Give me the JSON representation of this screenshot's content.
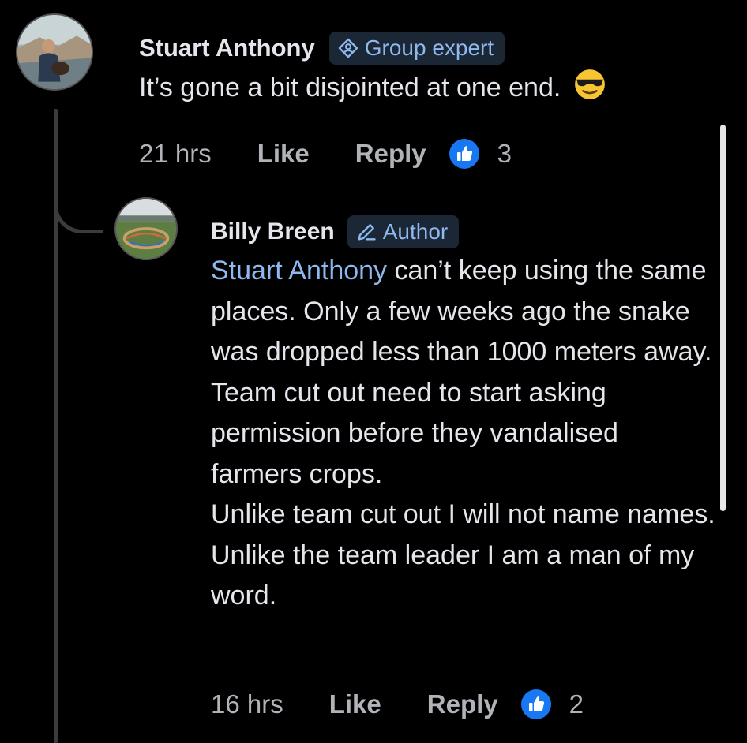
{
  "comment1": {
    "author": "Stuart Anthony",
    "badge": "Group expert",
    "badge_icon": "group-expert-icon",
    "text": "It’s gone a bit disjointed at one end.",
    "emoji": "smiling-face-with-sunglasses",
    "time": "21 hrs",
    "like_label": "Like",
    "reply_label": "Reply",
    "reaction": "like",
    "reaction_count": "3"
  },
  "comment2": {
    "author": "Billy Breen",
    "badge": "Author",
    "badge_icon": "pencil-icon",
    "mention": "Stuart Anthony",
    "first_text": " can’t keep using the same places. Only a few weeks ago the snake was dropped less than 1000 meters away.",
    "paragraphs": [
      "Team cut out need to start asking permission before they vandalised farmers crops.",
      "Unlike team cut out I will not name names. Unlike the team leader I am a man of my word."
    ],
    "time": "16 hrs",
    "like_label": "Like",
    "reply_label": "Reply",
    "reaction": "like",
    "reaction_count": "2"
  },
  "colors": {
    "background": "#000000",
    "text": "#e4e6eb",
    "secondary_text": "#b0b3b8",
    "link": "#8fb8ee",
    "badge_bg": "#1b2735",
    "like_blue": "#1877f2"
  }
}
